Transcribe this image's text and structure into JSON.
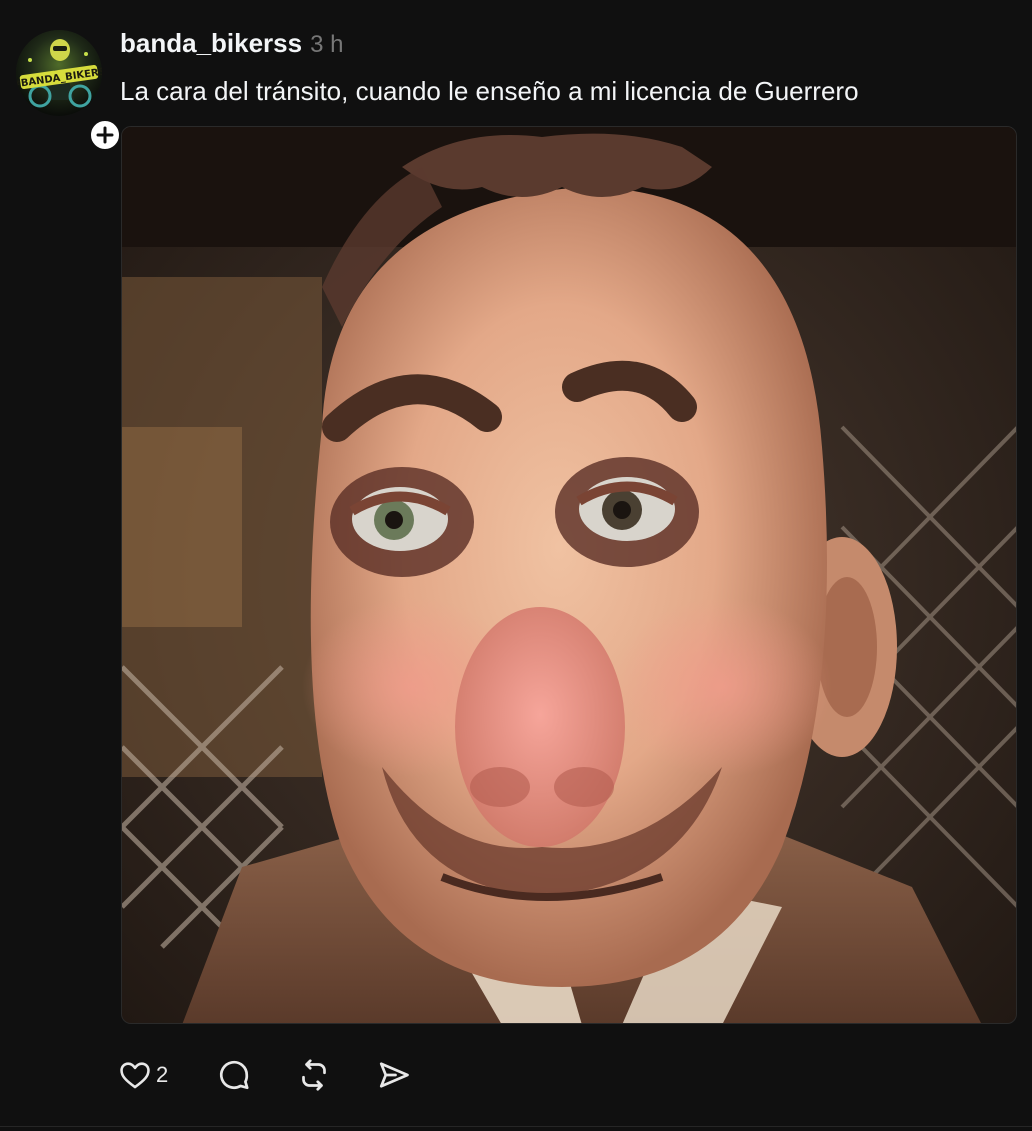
{
  "post": {
    "username": "banda_bikerss",
    "timestamp": "3 h",
    "caption": "La cara del tránsito, cuando le enseño a mi licencia de Guerrero",
    "avatar_logo_text": "#BANDA_BIKERS",
    "media_description_icon": "meme-image"
  },
  "actions": {
    "like_icon": "heart-icon",
    "like_count": "2",
    "comment_icon": "comment-icon",
    "repost_icon": "repost-icon",
    "share_icon": "share-icon"
  },
  "colors": {
    "background": "#101010",
    "text_primary": "#f3f5f7",
    "text_secondary": "#777777",
    "icon": "#e8e8e8"
  }
}
